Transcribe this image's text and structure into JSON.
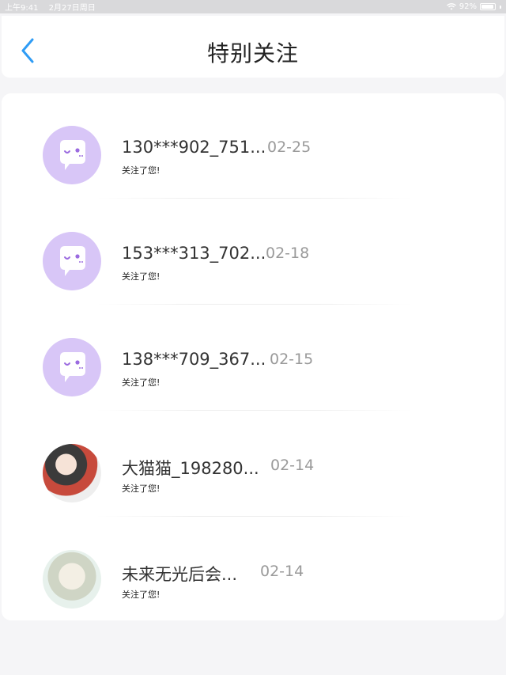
{
  "status_bar": {
    "time": "上午9:41",
    "date": "2月27日周日",
    "battery": "92%",
    "battery_level": 0.92
  },
  "header": {
    "title": "特别关注",
    "back_icon": "chevron-left-icon"
  },
  "colors": {
    "accent": "#2f9cf5",
    "avatar_default": "#d8c6f7",
    "avatar_face": "#ffffff",
    "avatar_eye": "#9b6be0"
  },
  "items": [
    {
      "name": "130***902_751...",
      "date": "02-25",
      "message": "关注了您!",
      "avatar": "default-avatar-icon"
    },
    {
      "name": "153***313_702...",
      "date": "02-18",
      "message": "关注了您!",
      "avatar": "default-avatar-icon"
    },
    {
      "name": "138***709_367...",
      "date": "02-15",
      "message": "关注了您!",
      "avatar": "default-avatar-icon"
    },
    {
      "name": "大猫猫_198280...",
      "date": "02-14",
      "message": "关注了您!",
      "avatar": "user-photo-avatar"
    },
    {
      "name": "未来无光后会...",
      "date": "02-14",
      "message": "关注了您!",
      "avatar": "user-photo-avatar"
    }
  ]
}
